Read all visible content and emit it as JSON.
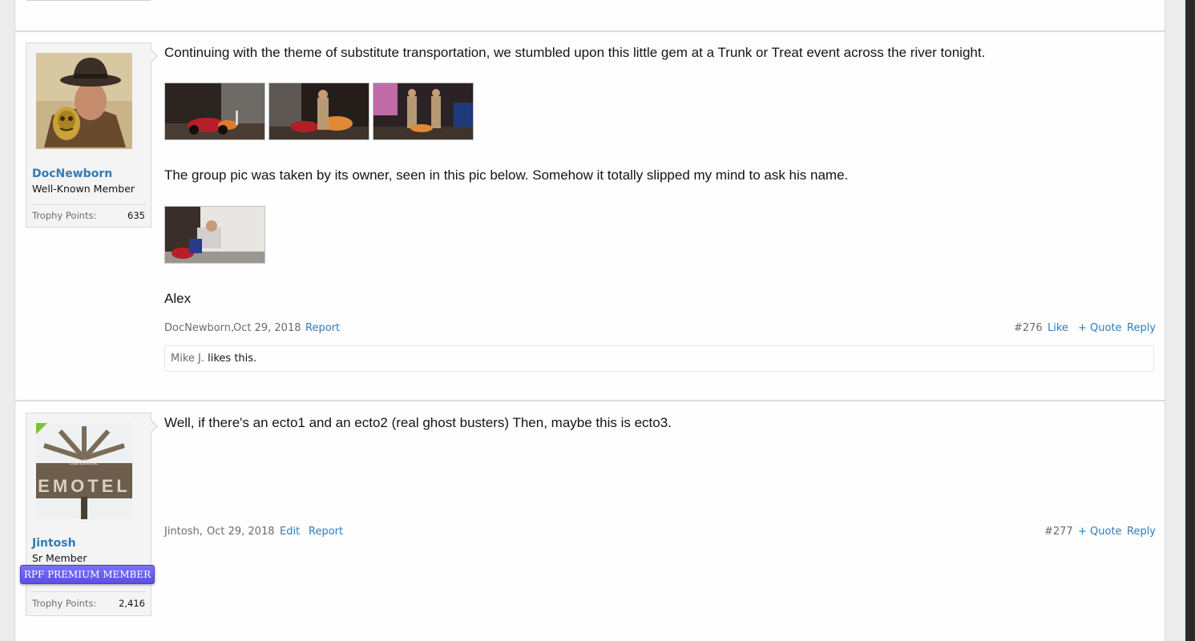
{
  "posts": [
    {
      "author": "DocNewborn",
      "user_title": "Well-Known Member",
      "trophy_label": "Trophy Points:",
      "trophy_points": "635",
      "text_1": "Continuing with the theme of substitute transportation, we stumbled upon this little gem at a Trunk or Treat event across the river tonight.",
      "text_2": "The group pic was taken by its owner, seen in this pic below. Somehow it totally slipped my mind to ask his name.",
      "text_3": "Alex",
      "meta_author": "DocNewborn,",
      "date": "Oct 29, 2018",
      "actions": {
        "report": "Report",
        "like": "Like",
        "quote": "+ Quote",
        "reply": "Reply"
      },
      "post_number": "#276",
      "likes": {
        "liker": "Mike J.",
        "suffix": " likes this."
      }
    },
    {
      "author": "Jintosh",
      "user_title": "Sr Member",
      "badge": "RPF PREMIUM MEMBER",
      "avatar_sign": "EMOTEL",
      "avatar_script": "Sunshine",
      "trophy_label": "Trophy Points:",
      "trophy_points": "2,416",
      "text_1": "Well, if there's an ecto1 and an ecto2 (real ghost busters) Then, maybe this is ecto3.",
      "meta_author": "Jintosh,",
      "date": "Oct 29, 2018",
      "actions": {
        "edit": "Edit",
        "report": "Report",
        "quote": "+ Quote",
        "reply": "Reply"
      },
      "post_number": "#277"
    }
  ],
  "colors": {
    "link": "#2f7cb9",
    "premium": "#5a4fe6",
    "text": "#141414",
    "muted": "#6b6b6b"
  }
}
